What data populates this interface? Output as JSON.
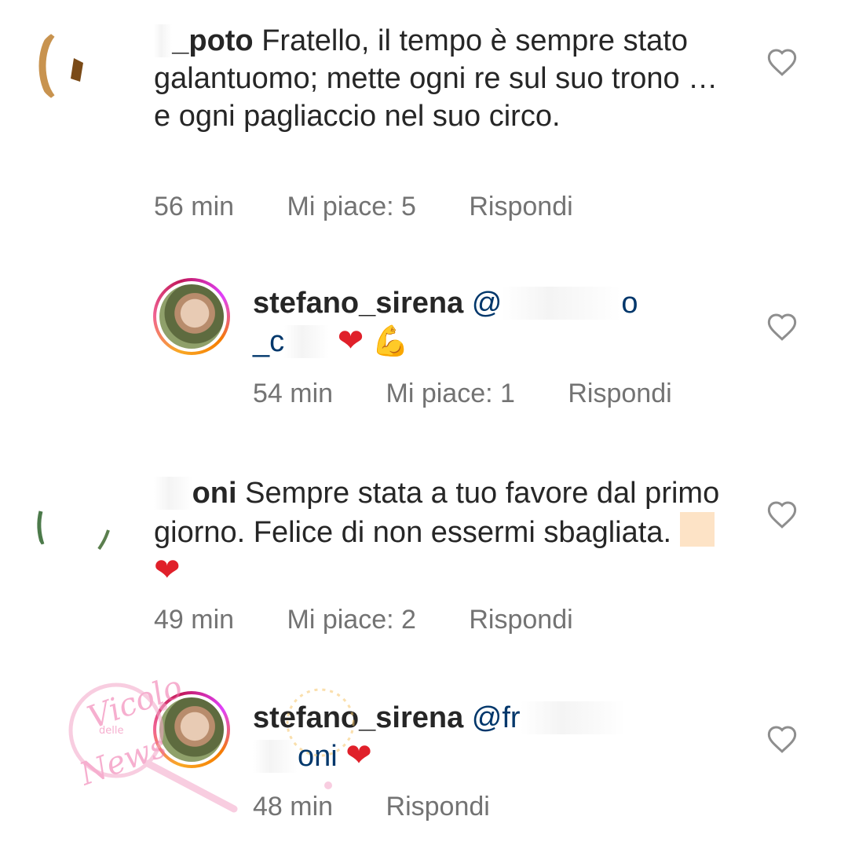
{
  "comments": [
    {
      "username": "",
      "username_visible": "_poto",
      "text": " Fratello, il tempo è sempre stato galantuomo; mette ogni re sul suo trono … e ogni pagliaccio nel suo circo.",
      "time": "56 min",
      "likes": "Mi piace: 5",
      "reply": "Rispondi"
    },
    {
      "username": "stefano_sirena",
      "mention": "@",
      "mention_tail": "o",
      "line2": "_c",
      "time": "54 min",
      "likes": "Mi piace: 1",
      "reply": "Rispondi"
    },
    {
      "username_visible": "oni",
      "text": " Sempre stata a tuo favore dal primo giorno. Felice di non essermi sbagliata.",
      "time": "49 min",
      "likes": "Mi piace: 2",
      "reply": "Rispondi"
    },
    {
      "username": "stefano_sirena",
      "mention": "@fr",
      "line2": "oni",
      "time": "48 min",
      "reply": "Rispondi"
    }
  ],
  "icons": {
    "like": "heart-outline-icon",
    "red_heart": "❤",
    "flexed_biceps": "💪"
  },
  "watermark": {
    "text": "Vicolo delle News"
  },
  "colors": {
    "text": "#262626",
    "meta": "#737373",
    "mention": "#00376b",
    "heart_red": "#e0202a"
  }
}
